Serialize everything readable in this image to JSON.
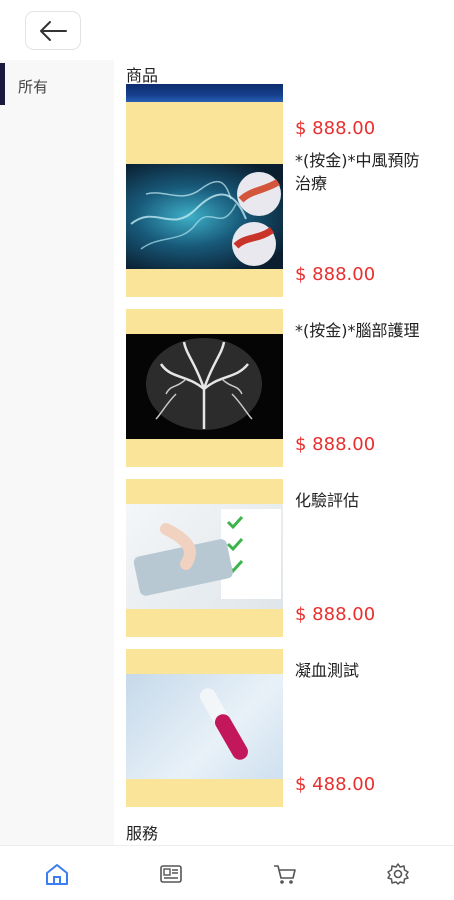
{
  "header": {
    "back_icon": "arrow-left-icon"
  },
  "sidebar": {
    "items": [
      {
        "label": "所有",
        "active": true
      }
    ]
  },
  "sections": [
    {
      "title": "商品"
    },
    {
      "title": "服務"
    }
  ],
  "products": [
    {
      "name": "",
      "price": "$ 888.00",
      "image": "blue-banner"
    },
    {
      "name": "*(按金)*中風預防治療",
      "price": "$ 888.00",
      "image": "brain-vessels"
    },
    {
      "name": "*(按金)*腦部護理",
      "price": "$ 888.00",
      "image": "brain-angiogram"
    },
    {
      "name": "化驗評估",
      "price": "$ 888.00",
      "image": "lab-report"
    },
    {
      "name": "凝血測試",
      "price": "$ 488.00",
      "image": "blood-tube"
    }
  ],
  "tabbar": [
    {
      "icon": "home-icon",
      "active": true
    },
    {
      "icon": "news-icon",
      "active": false
    },
    {
      "icon": "cart-icon",
      "active": false
    },
    {
      "icon": "settings-icon",
      "active": false
    }
  ],
  "colors": {
    "accent": "#3b7ef0",
    "price": "#e8302f",
    "thumb_bg": "#f9e49a",
    "sidebar_active": "#1a1a40"
  }
}
